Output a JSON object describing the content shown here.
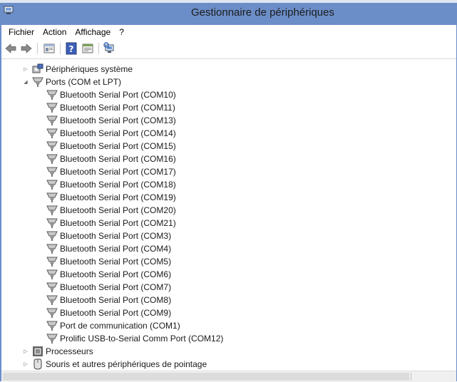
{
  "window": {
    "title": "Gestionnaire de périphériques"
  },
  "menu": {
    "items": [
      "Fichier",
      "Action",
      "Affichage",
      "?"
    ]
  },
  "toolbar": {
    "icons": [
      "back-arrow-icon",
      "forward-arrow-icon",
      "show-hide-console-tree-icon",
      "help-icon",
      "properties-icon",
      "scan-hardware-changes-icon"
    ]
  },
  "tree": {
    "system_devices": "Périphériques système",
    "ports": "Ports (COM et LPT)",
    "port_items": [
      "Bluetooth Serial Port (COM10)",
      "Bluetooth Serial Port (COM11)",
      "Bluetooth Serial Port (COM13)",
      "Bluetooth Serial Port (COM14)",
      "Bluetooth Serial Port (COM15)",
      "Bluetooth Serial Port (COM16)",
      "Bluetooth Serial Port (COM17)",
      "Bluetooth Serial Port (COM18)",
      "Bluetooth Serial Port (COM19)",
      "Bluetooth Serial Port (COM20)",
      "Bluetooth Serial Port (COM21)",
      "Bluetooth Serial Port (COM3)",
      "Bluetooth Serial Port (COM4)",
      "Bluetooth Serial Port (COM5)",
      "Bluetooth Serial Port (COM6)",
      "Bluetooth Serial Port (COM7)",
      "Bluetooth Serial Port (COM8)",
      "Bluetooth Serial Port (COM9)",
      "Port de communication (COM1)",
      "Prolific USB-to-Serial Comm Port (COM12)"
    ],
    "processors": "Processeurs",
    "mice": "Souris et autres périphériques de pointage"
  },
  "colors": {
    "titlebar": "#6c8ec8",
    "background": "#ffffff"
  }
}
